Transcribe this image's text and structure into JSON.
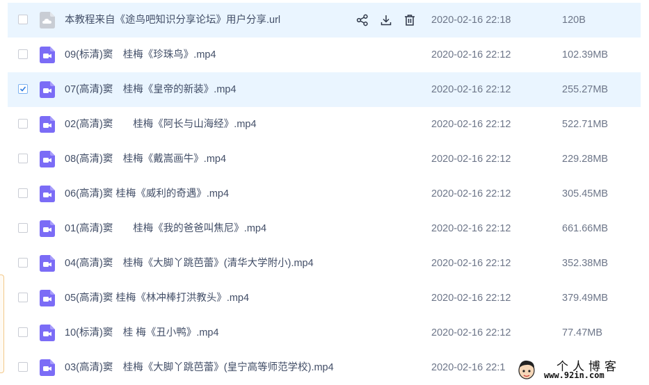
{
  "files": [
    {
      "name": "本教程来自《途鸟吧知识分享论坛》用户分享.url",
      "date": "2020-02-16 22:18",
      "size": "120B",
      "type": "url",
      "checked": false,
      "hover": true,
      "actions": [
        {
          "icon": "share-icon"
        },
        {
          "icon": "download-icon"
        },
        {
          "icon": "delete-icon"
        }
      ]
    },
    {
      "name": "09(标清)窦　桂梅《珍珠鸟》.mp4",
      "date": "2020-02-16 22:12",
      "size": "102.39MB",
      "type": "video",
      "checked": false
    },
    {
      "name": "07(高清)窦　桂梅《皇帝的新装》.mp4",
      "date": "2020-02-16 22:12",
      "size": "255.27MB",
      "type": "video",
      "checked": true
    },
    {
      "name": "02(高清)窦　　桂梅《阿长与山海经》.mp4",
      "date": "2020-02-16 22:12",
      "size": "522.71MB",
      "type": "video",
      "checked": false
    },
    {
      "name": "08(高清)窦　桂梅《戴嵩画牛》.mp4",
      "date": "2020-02-16 22:12",
      "size": "229.28MB",
      "type": "video",
      "checked": false
    },
    {
      "name": "06(高清)窦 桂梅《威利的奇遇》.mp4",
      "date": "2020-02-16 22:12",
      "size": "305.45MB",
      "type": "video",
      "checked": false
    },
    {
      "name": "01(高清)窦　　桂梅《我的爸爸叫焦尼》.mp4",
      "date": "2020-02-16 22:12",
      "size": "661.66MB",
      "type": "video",
      "checked": false
    },
    {
      "name": "04(高清)窦　桂梅《大脚丫跳芭蕾》(清华大学附小).mp4",
      "date": "2020-02-16 22:12",
      "size": "352.38MB",
      "type": "video",
      "checked": false
    },
    {
      "name": "05(高清)窦 桂梅《林冲棒打洪教头》.mp4",
      "date": "2020-02-16 22:12",
      "size": "379.49MB",
      "type": "video",
      "checked": false
    },
    {
      "name": "10(标清)窦　桂 梅《丑小鸭》.mp4",
      "date": "2020-02-16 22:12",
      "size": "77.47MB",
      "type": "video",
      "checked": false
    },
    {
      "name": "03(高清)窦　桂梅《大脚丫跳芭蕾》(皇宁高等师范学校).mp4",
      "date": "2020-02-16 22:1",
      "size": "",
      "type": "video",
      "checked": false
    }
  ],
  "watermark": {
    "title": "个人博客",
    "url": "www.92in.com"
  },
  "colors": {
    "accent": "#06a7ff",
    "video_icon": "#7b6cf6",
    "url_icon": "#c9cdd4",
    "hover_bg": "#eaf5ff"
  }
}
